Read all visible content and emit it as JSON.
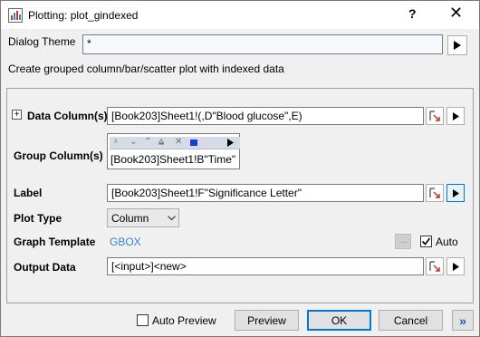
{
  "window": {
    "title": "Plotting: plot_gindexed",
    "help": "?",
    "close": "✕"
  },
  "dialog_theme": {
    "label": "Dialog Theme",
    "value": "*"
  },
  "description": "Create grouped column/bar/scatter plot with indexed data",
  "data_columns": {
    "expander": "+",
    "label": "Data Column(s)",
    "value": "[Book203]Sheet1!(,D\"Blood glucose\",E)"
  },
  "group_columns": {
    "label": "Group Column(s)",
    "value": "[Book203]Sheet1!B\"Time\""
  },
  "label_field": {
    "label": "Label",
    "value": "[Book203]Sheet1!F\"Significance Letter\""
  },
  "plot_type": {
    "label": "Plot Type",
    "value": "Column"
  },
  "graph_template": {
    "label": "Graph Template",
    "value": "GBOX",
    "browse": "...",
    "auto_label": "Auto",
    "auto_checked": true
  },
  "output_data": {
    "label": "Output Data",
    "value": "[<input>]<new>"
  },
  "footer": {
    "auto_preview_label": "Auto Preview",
    "preview": "Preview",
    "ok": "OK",
    "cancel": "Cancel",
    "more": "»"
  },
  "colors": {
    "link": "#3c7fd3",
    "accent": "#0078d7"
  }
}
